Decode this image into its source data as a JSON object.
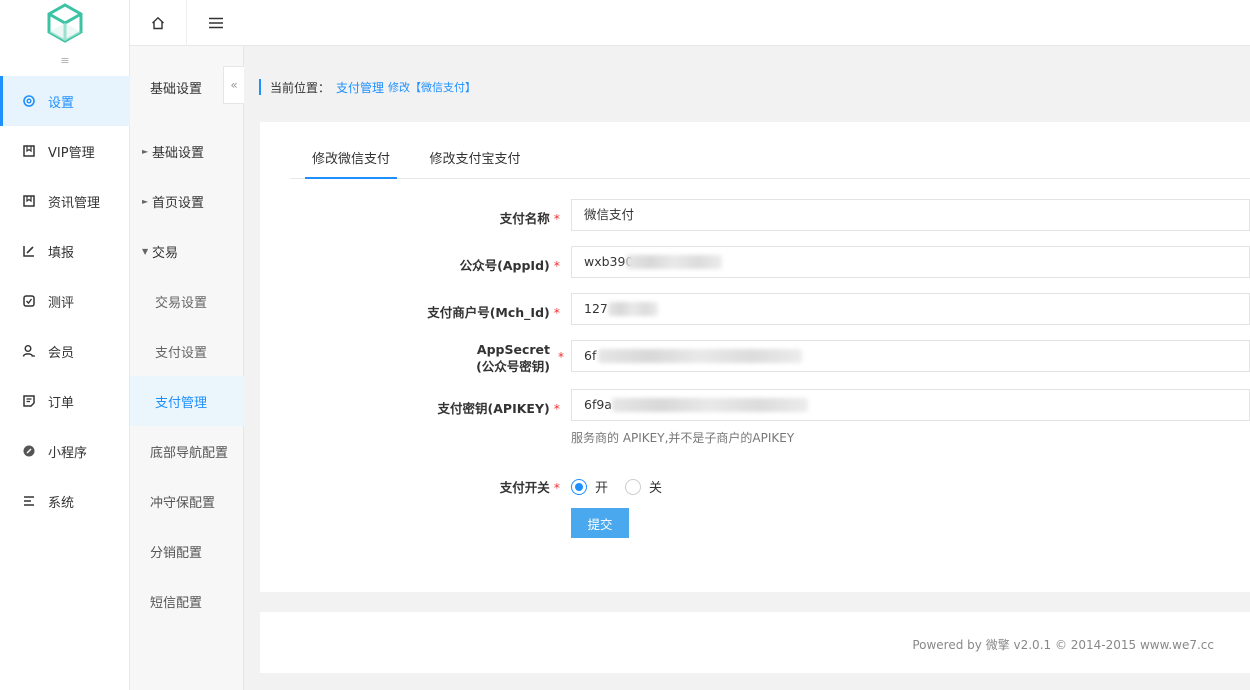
{
  "topbar": {
    "home_icon": "home-icon",
    "menu_icon": "hamburger-icon"
  },
  "nav1": {
    "items": [
      {
        "label": "设置",
        "icon": "gear-icon",
        "active": true
      },
      {
        "label": "VIP管理",
        "icon": "bookmark-icon"
      },
      {
        "label": "资讯管理",
        "icon": "bookmark-icon"
      },
      {
        "label": "填报",
        "icon": "edit-icon"
      },
      {
        "label": "测评",
        "icon": "check-icon"
      },
      {
        "label": "会员",
        "icon": "user-icon"
      },
      {
        "label": "订单",
        "icon": "document-icon"
      },
      {
        "label": "小程序",
        "icon": "link-icon"
      },
      {
        "label": "系统",
        "icon": "list-icon"
      }
    ]
  },
  "nav2": {
    "title": "基础设置",
    "items": [
      {
        "label": "基础设置",
        "type": "group"
      },
      {
        "label": "首页设置",
        "type": "group"
      },
      {
        "label": "交易",
        "type": "group-open"
      },
      {
        "label": "交易设置",
        "type": "sub"
      },
      {
        "label": "支付设置",
        "type": "sub"
      },
      {
        "label": "支付管理",
        "type": "sub",
        "active": true
      },
      {
        "label": "底部导航配置",
        "type": "plain"
      },
      {
        "label": "冲守保配置",
        "type": "plain"
      },
      {
        "label": "分销配置",
        "type": "plain"
      },
      {
        "label": "短信配置",
        "type": "plain"
      }
    ]
  },
  "breadcrumb": {
    "label": "当前位置：",
    "link": "支付管理",
    "mod": "修改【微信支付】"
  },
  "tabs": [
    "修改微信支付",
    "修改支付宝支付"
  ],
  "form": {
    "pay_name_label": "支付名称",
    "pay_name_value": "微信支付",
    "appid_label": "公众号(AppId)",
    "appid_value": "wxb390",
    "mchid_label": "支付商户号(Mch_Id)",
    "mchid_value": "127",
    "appsecret_label_1": "AppSecret",
    "appsecret_label_2": "(公众号密钥)",
    "appsecret_value": "6f",
    "apikey_label": "支付密钥(APIKEY)",
    "apikey_value": "6f9a",
    "apikey_hint": "服务商的 APIKEY,并不是子商户的APIKEY",
    "switch_label": "支付开关",
    "switch_on": "开",
    "switch_off": "关",
    "required_mark": "*",
    "submit": "提交"
  },
  "footer": "Powered by 微擎 v2.0.1 © 2014-2015 www.we7.cc",
  "colors": {
    "accent": "#1e90ff",
    "button": "#4aa8ee",
    "required": "#e33",
    "logo": "#3cc3a3"
  }
}
